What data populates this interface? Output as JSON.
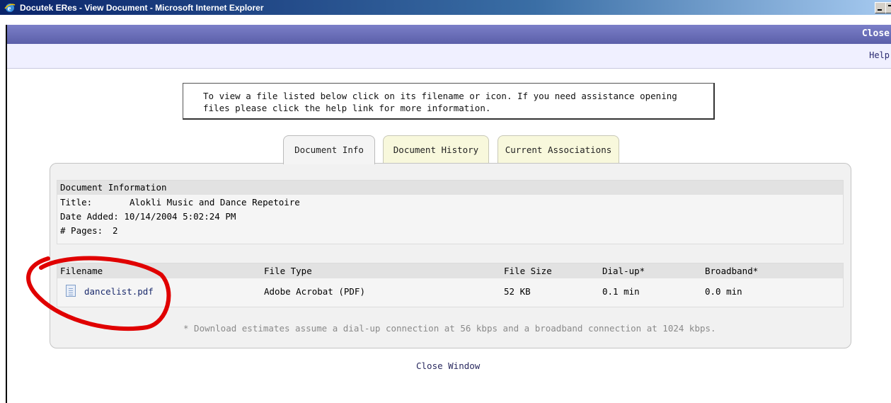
{
  "window": {
    "title": "Docutek ERes - View Document - Microsoft Internet Explorer",
    "icon": "ie-icon"
  },
  "toolbar": {
    "close_label": "Close",
    "help_label": "Help"
  },
  "instructions": "To view a file listed below click on its filename or icon. If you need assistance opening files please click the help link for more information.",
  "tabs": [
    {
      "label": "Document Info",
      "active": true
    },
    {
      "label": "Document History",
      "active": false
    },
    {
      "label": "Current Associations",
      "active": false
    }
  ],
  "document_info": {
    "header": "Document Information",
    "rows": [
      {
        "label": "Title:",
        "value": "Alokli Music and Dance Repetoire"
      },
      {
        "label": "Date Added:",
        "value": "10/14/2004 5:02:24 PM"
      },
      {
        "label": "# Pages:",
        "value": "2"
      }
    ]
  },
  "files": {
    "columns": [
      "Filename",
      "File Type",
      "File Size",
      "Dial-up*",
      "Broadband*"
    ],
    "rows": [
      {
        "filename": "dancelist.pdf",
        "type": "Adobe Acrobat (PDF)",
        "size": "52 KB",
        "dialup": "0.1 min",
        "broadband": "0.0 min",
        "icon": "pdf-file-icon"
      }
    ]
  },
  "footnote": "* Download estimates assume a dial-up connection at 56 kbps and a broadband connection at 1024 kbps.",
  "close_window_label": "Close Window",
  "colors": {
    "titlebar": "#0a246a",
    "close_bar": "#6b6fb9",
    "annotation": "#e00000"
  }
}
